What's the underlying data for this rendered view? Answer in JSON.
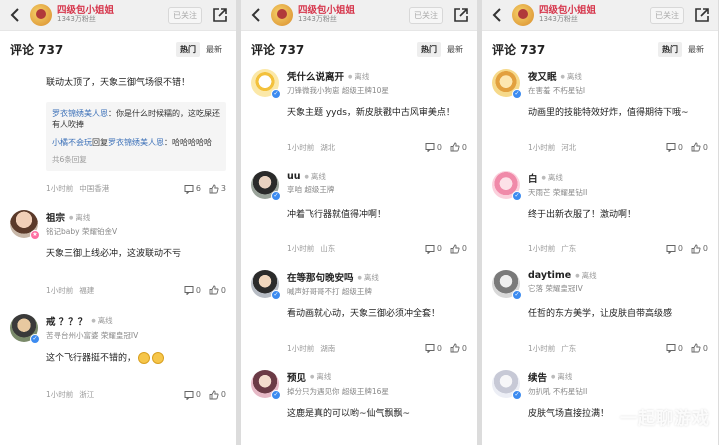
{
  "account": {
    "name": "四级包小姐姐",
    "fans": "1343万粉丝",
    "follow_label": "已关注"
  },
  "header": {
    "title": "评论 737",
    "sort_hot": "热门",
    "sort_new": "最新"
  },
  "panel1": {
    "first": {
      "text": "联动太顶了，天象三御气场很不错！",
      "replies": [
        {
          "name": "罗衣锦绣美人恩",
          "sep": "：",
          "text": "你是什么时候糯的，这吃屎还有人吹捧"
        },
        {
          "name": "小橘不会玩",
          "mid": "回复",
          "name2": "罗衣锦绣美人恩",
          "sep": "：",
          "text": "哈哈哈哈哈"
        }
      ],
      "more": "共6条回复",
      "time": "1小时前",
      "loc": "中国香港",
      "comments": "6",
      "likes": "3"
    },
    "c2": {
      "name": "祖宗",
      "status": "离线",
      "sub": "铭记baby   荣耀铂金V",
      "text": "天象三御上线必冲，这波联动不亏",
      "time": "1小时前",
      "loc": "福建",
      "comments": "0",
      "likes": "0"
    },
    "c3": {
      "name": "戒 ？？？",
      "status": "离线",
      "sub": "苦寻台州小富婆   荣耀皇冠IV",
      "text": "这个飞行器挺不错的，",
      "time": "1小时前",
      "loc": "浙江",
      "comments": "0",
      "likes": "0"
    }
  },
  "panel2": {
    "c1": {
      "name": "凭什么说离开",
      "status": "离线",
      "sub": "刀锋微我小狗崽   超级王牌10星",
      "text": "天象主题 yyds，新皮肤戳中古风审美点！",
      "time": "1小时前",
      "loc": "湖北",
      "comments": "0",
      "likes": "0"
    },
    "c2": {
      "name": "uu",
      "status": "离线",
      "sub": "享咱   超级王牌",
      "text": "冲着飞行器就值得冲啊！",
      "time": "1小时前",
      "loc": "山东",
      "comments": "0",
      "likes": "0"
    },
    "c3": {
      "name": "在等那句晚安吗",
      "status": "离线",
      "sub": "喊声好哥哥不打   超级王牌",
      "text": "看动画就心动，天象三御必须冲全套！",
      "time": "1小时前",
      "loc": "湖南",
      "comments": "0",
      "likes": "0"
    },
    "c4": {
      "name": "预见",
      "status": "离线",
      "sub": "掉分只为遇见你   超级王牌16星",
      "text": "这鹿是真的可以哟~仙气飘飘~"
    }
  },
  "panel3": {
    "c1": {
      "name": "夜又眠",
      "status": "离线",
      "sub": "在害羞   不朽星钻I",
      "text": "动画里的技能特效好炸，值得期待下哦~",
      "time": "1小时前",
      "loc": "河北",
      "comments": "0",
      "likes": "0"
    },
    "c2": {
      "name": "白",
      "status": "离线",
      "sub": "天雨芒   荣耀星钻II",
      "text": "终于出新衣服了！激动啊！",
      "time": "1小时前",
      "loc": "广东",
      "comments": "0",
      "likes": "0"
    },
    "c3": {
      "name": "daytime",
      "status": "离线",
      "sub": "它落   荣耀皇冠IV",
      "text": "任哲的东方美学，让皮肤自带高级感",
      "time": "1小时前",
      "loc": "广东",
      "comments": "0",
      "likes": "0"
    },
    "c4": {
      "name": "续告",
      "status": "离线",
      "sub": "勿扒吼   不朽星钻II",
      "text": "皮肤气场直接拉满！"
    }
  },
  "watermark": "一起聊游戏",
  "colors": {
    "accent_name": "#d6354b",
    "reply_name": "#3b70b8",
    "verified": "#3c8bf0"
  }
}
